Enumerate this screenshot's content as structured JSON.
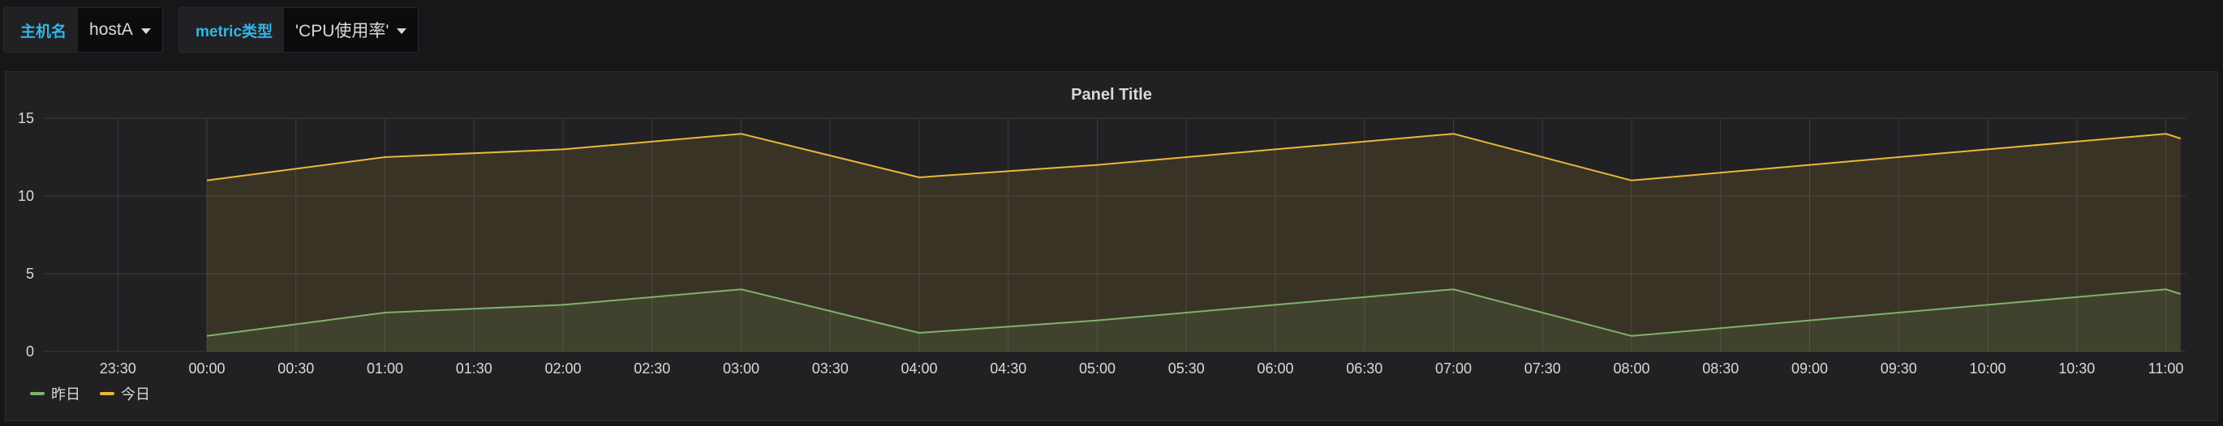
{
  "variables": [
    {
      "label": "主机名",
      "value": "hostA"
    },
    {
      "label": "metric类型",
      "value": "'CPU使用率'"
    }
  ],
  "panel": {
    "title": "Panel Title"
  },
  "colors": {
    "series_yesterday": "#7eb26d",
    "series_today": "#eab839",
    "var_label": "#33b5e5"
  },
  "chart_data": {
    "type": "area",
    "title": "Panel Title",
    "xlabel": "",
    "ylabel": "",
    "ylim": [
      0,
      15
    ],
    "y_ticks": [
      "0",
      "5",
      "10",
      "15"
    ],
    "x_ticks": [
      "23:30",
      "00:00",
      "00:30",
      "01:00",
      "01:30",
      "02:00",
      "02:30",
      "03:00",
      "03:30",
      "04:00",
      "04:30",
      "05:00",
      "05:30",
      "06:00",
      "06:30",
      "07:00",
      "07:30",
      "08:00",
      "08:30",
      "09:00",
      "09:30",
      "10:00",
      "10:30",
      "11:00"
    ],
    "x": [
      "00:00",
      "01:00",
      "02:00",
      "03:00",
      "04:00",
      "05:00",
      "06:00",
      "07:00",
      "08:00",
      "09:00",
      "10:00",
      "11:00",
      "11:05"
    ],
    "grid": true,
    "legend": "bottom-left",
    "series": [
      {
        "name": "昨日",
        "color": "#7eb26d",
        "values": [
          1,
          2.5,
          3,
          4,
          1.2,
          2,
          3,
          4,
          1,
          2,
          3,
          4,
          3.7
        ]
      },
      {
        "name": "今日",
        "color": "#eab839",
        "values": [
          11,
          12.5,
          13,
          14,
          11.2,
          12,
          13,
          14,
          11,
          12,
          13,
          14,
          13.7
        ]
      }
    ]
  }
}
